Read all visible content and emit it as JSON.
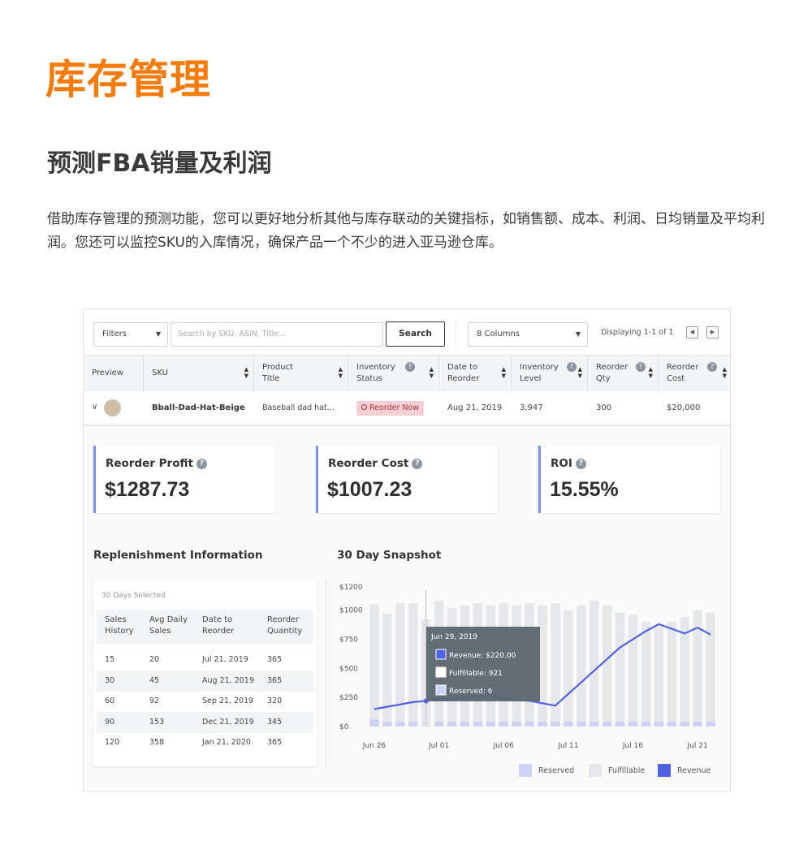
{
  "page": {
    "title": "库存管理",
    "subtitle": "预测FBA销量及利润",
    "description": "借助库存管理的预测功能，您可以更好地分析其他与库存联动的关键指标，如销售额、成本、利润、日均销量及平均利润。您还可以监控SKU的入库情况，确保产品一个不少的进入亚马逊仓库。"
  },
  "toolbar": {
    "filters_label": "Filters",
    "search_placeholder": "Search by SKU, ASIN, Title...",
    "search_button": "Search",
    "columns_label": "8 Columns",
    "display_text": "Displaying 1-1 of 1"
  },
  "table": {
    "headers": [
      "Preview",
      "SKU",
      "Product Title",
      "Inventory Status",
      "Date to Reorder",
      "Inventory Level",
      "Reorder Qty",
      "Reorder Cost"
    ],
    "row": {
      "sku": "Bball-Dad-Hat-Beige",
      "title": "Baseball dad hat…",
      "status": "Reorder Now",
      "date": "Aug 21, 2019",
      "level": "3,947",
      "qty": "300",
      "cost": "$20,000"
    }
  },
  "kpis": [
    {
      "label": "Reorder Profit",
      "value": "$1287.73"
    },
    {
      "label": "Reorder Cost",
      "value": "$1007.23"
    },
    {
      "label": "ROI",
      "value": "15.55%"
    }
  ],
  "replenishment": {
    "title": "Replenishment Information",
    "selected": "30 Days Selected",
    "headers": [
      "Sales History",
      "Avg Daily Sales",
      "Date to Reorder",
      "Reorder Quantity"
    ],
    "rows": [
      [
        "15",
        "20",
        "Jul 21, 2019",
        "365"
      ],
      [
        "30",
        "45",
        "Aug 21, 2019",
        "365"
      ],
      [
        "60",
        "92",
        "Sep 21, 2019",
        "320"
      ],
      [
        "90",
        "153",
        "Dec 21, 2019",
        "345"
      ],
      [
        "120",
        "358",
        "Jan 21, 2020",
        "365"
      ]
    ]
  },
  "snapshot": {
    "title": "30 Day Snapshot",
    "tooltip": {
      "date": "Jun 29, 2019",
      "revenue": "Revenue: $220.00",
      "fulfillable": "Fulfillable: 921",
      "reserved": "Reserved: 6"
    },
    "legend": [
      "Reserved",
      "Fulfillable",
      "Revenue"
    ]
  },
  "colors": {
    "accent": "#f47b0c",
    "revenue": "#5063e0",
    "fulfillable": "#e6e7ea",
    "reserved": "#cdd2f8"
  },
  "chart_data": {
    "type": "bar",
    "ylim": [
      0,
      1200
    ],
    "yticks": [
      "$0",
      "$250",
      "$500",
      "$750",
      "$1000",
      "$1200"
    ],
    "xticks": [
      "Jun 26",
      "Jul 01",
      "Jul 06",
      "Jul 11",
      "Jul 16",
      "Jul 21"
    ],
    "x": [
      1,
      2,
      3,
      4,
      5,
      6,
      7,
      8,
      9,
      10,
      11,
      12,
      13,
      14,
      15,
      16,
      17,
      18,
      19,
      20,
      21,
      22,
      23,
      24,
      25,
      26,
      27
    ],
    "series": [
      {
        "name": "Fulfillable",
        "values": [
          1050,
          970,
          1060,
          1060,
          921,
          1080,
          1020,
          1040,
          1060,
          1040,
          1060,
          1040,
          1060,
          1040,
          1060,
          1000,
          1040,
          1080,
          1040,
          980,
          960,
          900,
          860,
          900,
          940,
          1000,
          980
        ]
      },
      {
        "name": "Reserved",
        "values": [
          60,
          40,
          40,
          40,
          6,
          40,
          40,
          40,
          40,
          40,
          40,
          40,
          40,
          40,
          40,
          40,
          40,
          40,
          40,
          40,
          40,
          40,
          40,
          40,
          40,
          40,
          40
        ]
      },
      {
        "name": "Revenue",
        "values": [
          150,
          170,
          190,
          210,
          220,
          240,
          240,
          250,
          260,
          260,
          240,
          230,
          220,
          200,
          180,
          280,
          380,
          480,
          580,
          680,
          750,
          820,
          880,
          840,
          800,
          850,
          790
        ]
      }
    ]
  }
}
